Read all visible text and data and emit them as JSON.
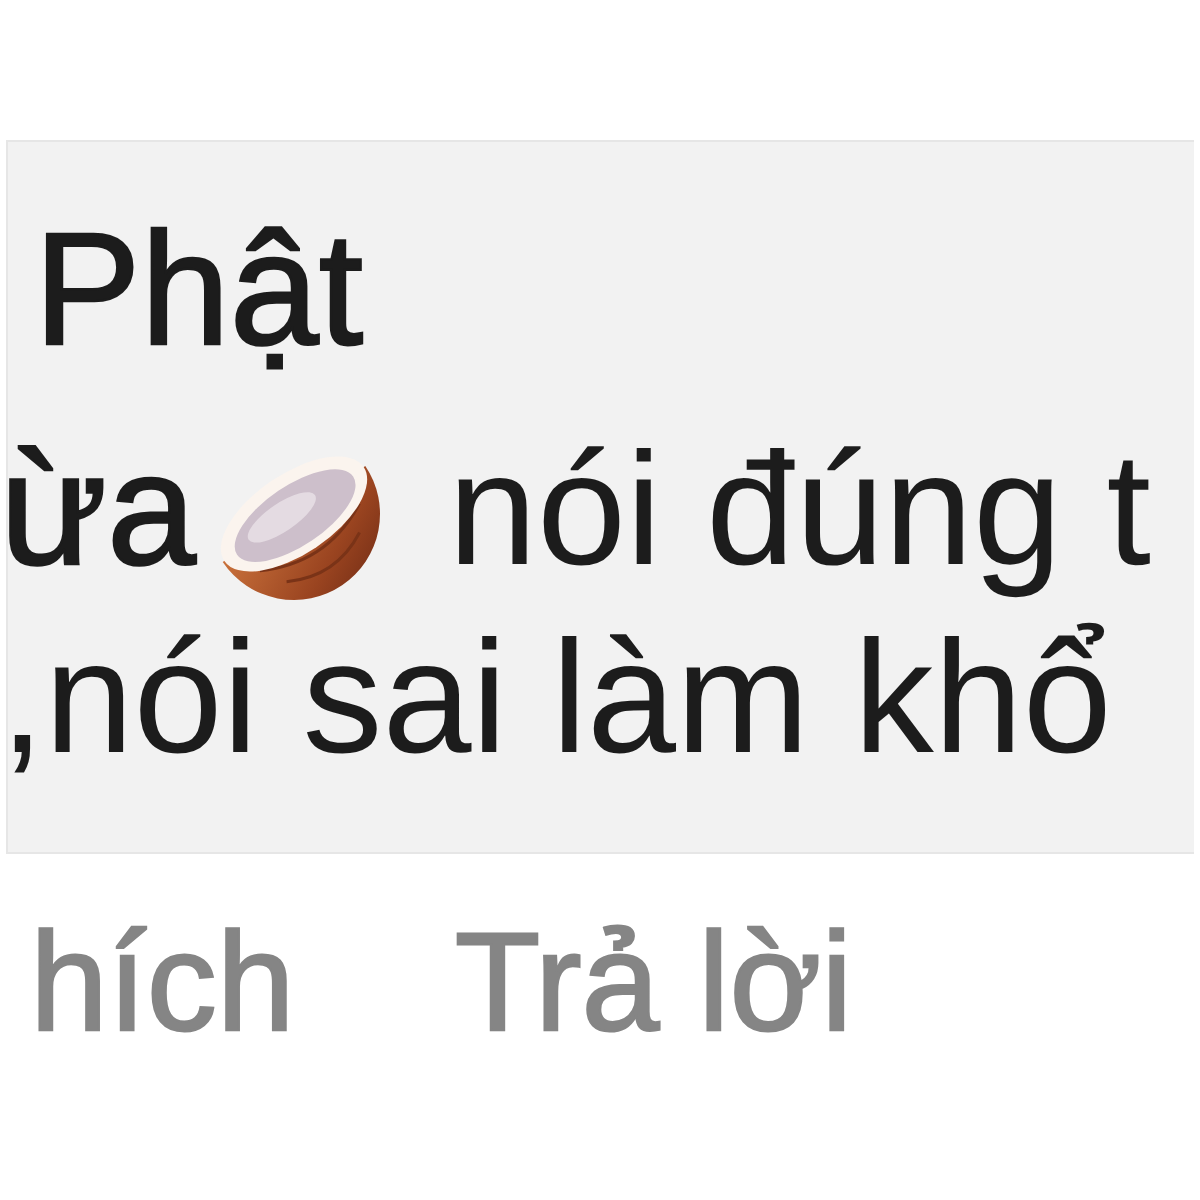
{
  "comment": {
    "author": "Phật",
    "body": {
      "mention": "ừa",
      "lines": [
        "nói đúng t",
        ",nói sai làm khổ"
      ]
    }
  },
  "actions": [
    {
      "label": "hích"
    },
    {
      "label": "Trả lời"
    }
  ]
}
